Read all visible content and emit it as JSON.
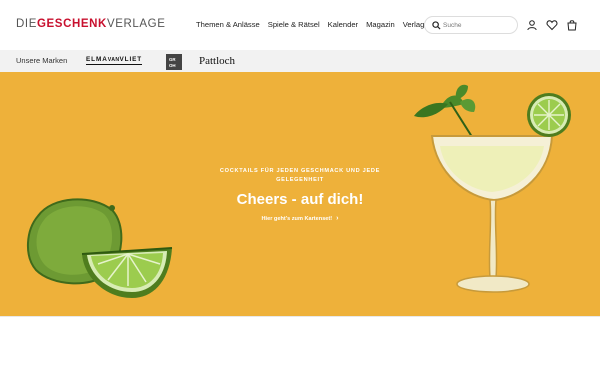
{
  "header": {
    "logo": {
      "part1": "DIE",
      "part2": "GESCHENK",
      "part3": "VERLAGE"
    },
    "nav": [
      {
        "label": "Themen & Anlässe"
      },
      {
        "label": "Spiele & Rätsel"
      },
      {
        "label": "Kalender"
      },
      {
        "label": "Magazin"
      },
      {
        "label": "Verlag"
      }
    ],
    "search": {
      "placeholder": "Suche",
      "icon": "search-icon"
    },
    "icons": [
      "user-icon",
      "heart-icon",
      "shopping-bag-icon"
    ]
  },
  "brands": {
    "label": "Unsere Marken",
    "items": [
      {
        "name": "ELMA",
        "small": "VAN",
        "name2": "VLIET"
      },
      {
        "groh": [
          "GR",
          "OH"
        ]
      },
      {
        "name": "Pattloch"
      }
    ]
  },
  "hero": {
    "background": "#eeb13a",
    "kicker": "COCKTAILS FÜR JEDEN GESCHMACK UND JEDE GELEGENHEIT",
    "headline": "Cheers - auf dich!",
    "cta": "Hier geht's zum Kartenset!",
    "cta_icon": "chevron-right-icon",
    "illustrations": [
      "lime-illustration",
      "lime-slice-illustration",
      "cocktail-glass-illustration"
    ]
  }
}
